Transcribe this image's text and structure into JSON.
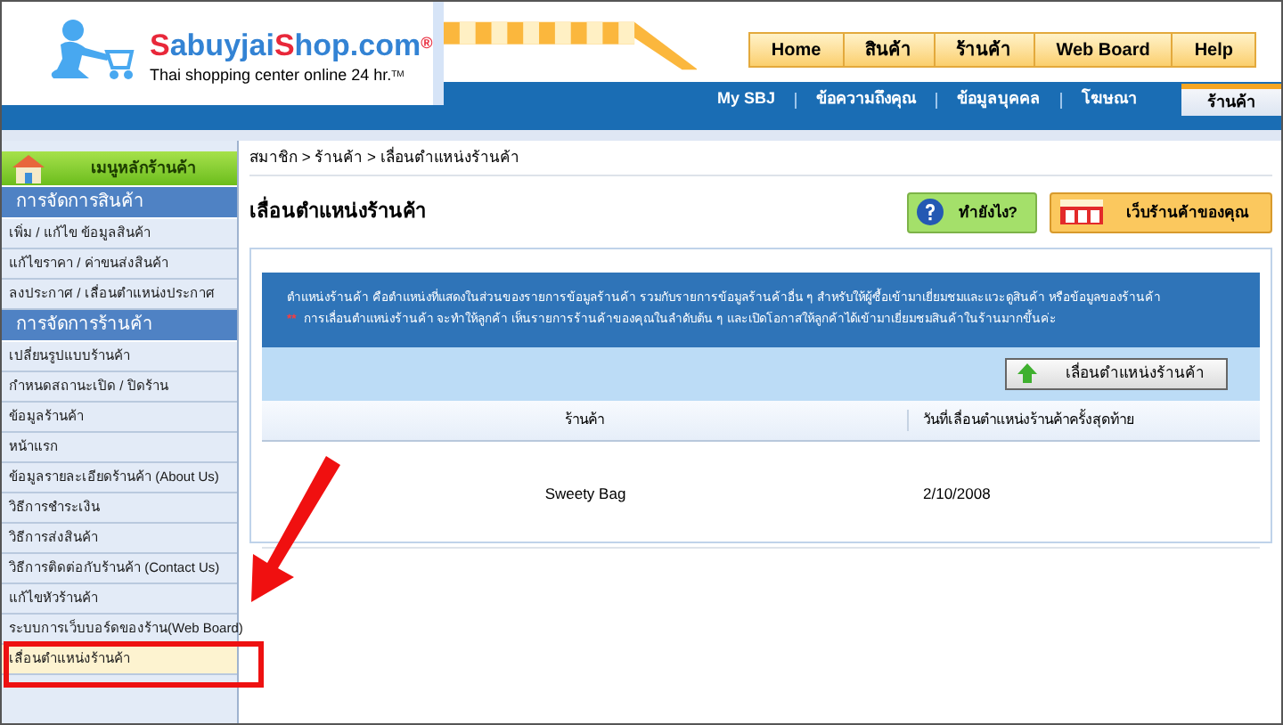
{
  "logo": {
    "name_a": "S",
    "name_b": "abuyjai",
    "name_c": "S",
    "name_d": "hop.com",
    "registered": "®",
    "tagline": "Thai shopping center online 24 hr.",
    "tm": "TM"
  },
  "top_nav": [
    "Home",
    "สินค้า",
    "ร้านค้า",
    "Web Board",
    "Help"
  ],
  "tabs": [
    {
      "label": "My SBJ",
      "selected": false
    },
    {
      "label": "ข้อความถึงคุณ",
      "selected": false
    },
    {
      "label": "ข้อมูลบุคคล",
      "selected": false
    },
    {
      "label": "โฆษณา",
      "selected": false
    },
    {
      "label": "ร้านค้า",
      "selected": true
    }
  ],
  "sidebar": {
    "items": [
      {
        "kind": "home",
        "label": "เมนูหลักร้านค้า",
        "selected": false
      },
      {
        "kind": "section",
        "label": "การจัดการสินค้า",
        "selected": false
      },
      {
        "kind": "item",
        "label": "เพิ่ม / แก้ไข ข้อมูลสินค้า",
        "selected": false
      },
      {
        "kind": "item",
        "label": "แก้ไขราคา / ค่าขนส่งสินค้า",
        "selected": false
      },
      {
        "kind": "item",
        "label": "ลงประกาศ / เลื่อนตำแหน่งประกาศ",
        "selected": false
      },
      {
        "kind": "section",
        "label": "การจัดการร้านค้า",
        "selected": false
      },
      {
        "kind": "item",
        "label": "เปลี่ยนรูปแบบร้านค้า",
        "selected": false
      },
      {
        "kind": "item",
        "label": "กำหนดสถานะเปิด / ปิดร้าน",
        "selected": false
      },
      {
        "kind": "item",
        "label": "ข้อมูลร้านค้า",
        "selected": false
      },
      {
        "kind": "item",
        "label": "หน้าแรก",
        "selected": false
      },
      {
        "kind": "item",
        "label": "ข้อมูลรายละเอียดร้านค้า (About Us)",
        "selected": false
      },
      {
        "kind": "item",
        "label": "วิธีการชำระเงิน",
        "selected": false
      },
      {
        "kind": "item",
        "label": "วิธีการส่งสินค้า",
        "selected": false
      },
      {
        "kind": "item",
        "label": "วิธีการติดต่อกับร้านค้า (Contact Us)",
        "selected": false
      },
      {
        "kind": "item",
        "label": "แก้ไขหัวร้านค้า",
        "selected": false
      },
      {
        "kind": "item",
        "label": "ระบบการเว็บบอร์ดของร้าน(Web Board)",
        "selected": false
      },
      {
        "kind": "item",
        "label": "เลื่อนตำแหน่งร้านค้า",
        "selected": true
      }
    ]
  },
  "breadcrumb": "สมาชิก > ร้านค้า > เลื่อนตำแหน่งร้านค้า",
  "page_title": "เลื่อนตำแหน่งร้านค้า",
  "help_button": "ทำยังไง?",
  "shop_button": "เว็บร้านค้าของคุณ",
  "info": {
    "line1": "ตำแหน่งร้านค้า คือตำแหน่งที่แสดงในส่วนของรายการข้อมูลร้านค้า รวมกับรายการข้อมูลร้านค้าอื่น ๆ สำหรับให้ผู้ซื้อเข้ามาเยี่ยมชมและแวะดูสินค้า หรือข้อมูลของร้านค้า",
    "mark": "**",
    "line2": "การเลื่อนตำแหน่งร้านค้า จะทำให้ลูกค้า เห็นรายการร้านค้าของคุณในลำดับต้น ๆ และเปิดโอกาสให้ลูกค้าได้เข้ามาเยี่ยมชมสินค้าในร้านมากขึ้นค่ะ"
  },
  "move_button": "เลื่อนตำแหน่งร้านค้า",
  "table": {
    "columns": [
      "ร้านค้า",
      "วันที่เลื่อนตำแหน่งร้านค้าครั้งสุดท้าย"
    ],
    "rows": [
      [
        "Sweety Bag",
        "2/10/2008"
      ]
    ]
  }
}
